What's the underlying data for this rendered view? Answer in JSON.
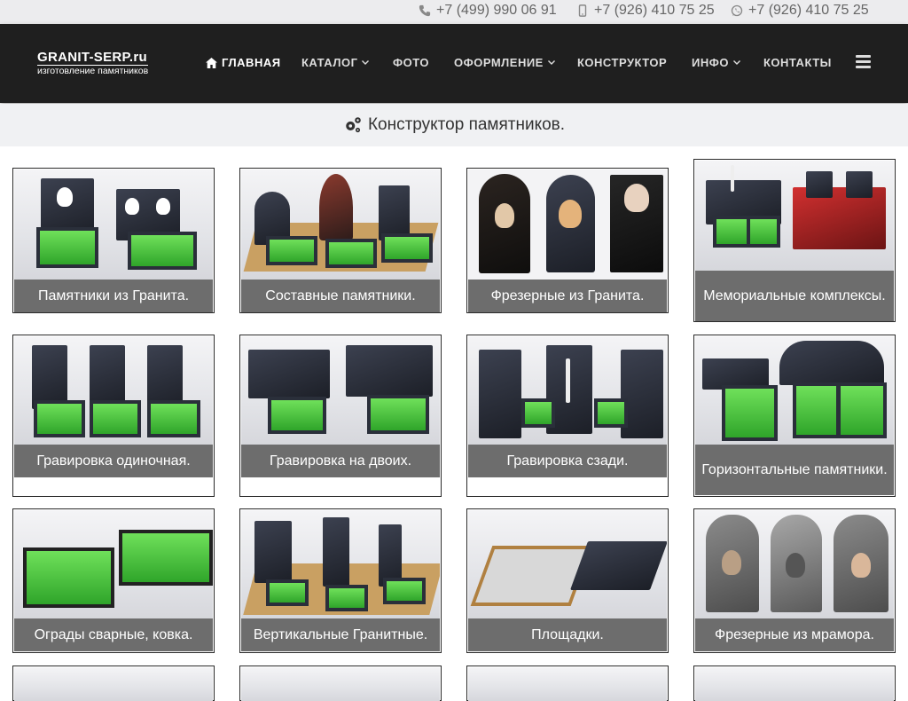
{
  "contacts": [
    {
      "icon": "phone-icon",
      "number": "+7 (499) 990 06 91"
    },
    {
      "icon": "mobile-icon",
      "number": "+7 (926) 410 75 25"
    },
    {
      "icon": "whatsapp-icon",
      "number": "+7 (926) 410 75 25"
    }
  ],
  "logo": {
    "title": "GRANIT-SERP.ru",
    "subtitle": "изготовление памятников"
  },
  "menu": [
    {
      "label": "ГЛАВНАЯ",
      "icon": "home-icon"
    },
    {
      "label": "КАТАЛОГ",
      "dropdown": true
    },
    {
      "label": "ФОТО"
    },
    {
      "label": "ОФОРМЛЕНИЕ",
      "dropdown": true
    },
    {
      "label": "КОНСТРУКТОР"
    },
    {
      "label": "ИНФО",
      "dropdown": true
    },
    {
      "label": "КОНТАКТЫ"
    }
  ],
  "page": {
    "heading": "Конструктор памятников.",
    "heading_icon": "gears-icon"
  },
  "cards": [
    {
      "label": "Памятники из Гранита."
    },
    {
      "label": "Составные памятники."
    },
    {
      "label": "Фрезерные из Гранита."
    },
    {
      "label": "Мемориальные комплексы."
    },
    {
      "label": "Гравировка одиночная."
    },
    {
      "label": "Гравировка на двоих."
    },
    {
      "label": "Гравировка сзади."
    },
    {
      "label": "Горизонтальные памятники."
    },
    {
      "label": "Ограды сварные, ковка."
    },
    {
      "label": "Вертикальные Гранитные."
    },
    {
      "label": "Площадки."
    },
    {
      "label": "Фрезерные из мрамора."
    }
  ],
  "colors": {
    "nav_bg": "#1f1f1f",
    "caption_bg": "#6d6d6d",
    "topbar_bg": "#ececee"
  }
}
